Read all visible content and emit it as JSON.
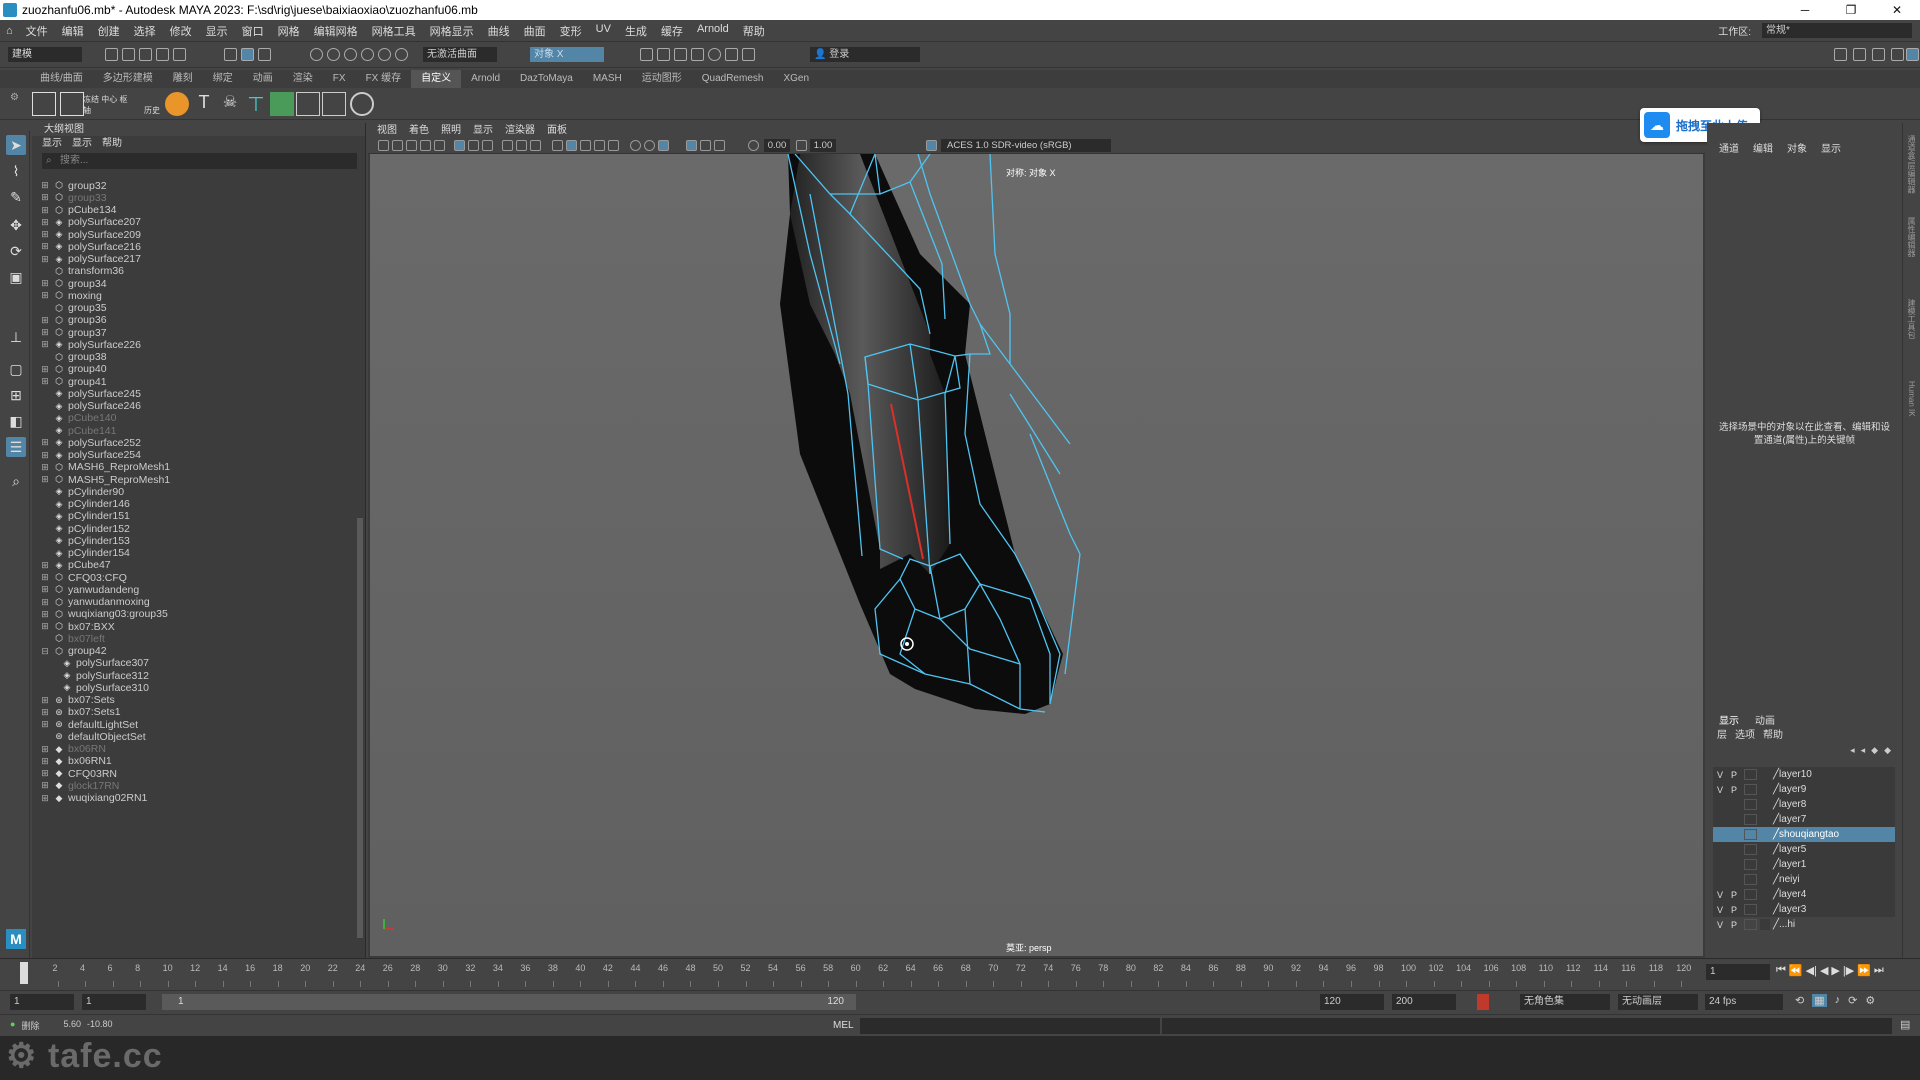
{
  "window": {
    "title": "zuozhanfu06.mb* - Autodesk MAYA 2023: F:\\sd\\rig\\juese\\baixiaoxiao\\zuozhanfu06.mb",
    "min": "─",
    "max": "❐",
    "close": "✕"
  },
  "menubar": {
    "items": [
      "文件",
      "编辑",
      "创建",
      "选择",
      "修改",
      "显示",
      "窗口",
      "网格",
      "编辑网格",
      "网格工具",
      "网格显示",
      "曲线",
      "曲面",
      "变形",
      "UV",
      "生成",
      "缓存",
      "Arnold",
      "帮助"
    ],
    "workspace_label": "工作区:",
    "workspace_value": "常规*"
  },
  "statusline": {
    "mode": "建模",
    "live_surface": "无激活曲面",
    "symmetry": "对象 X",
    "login": "登录"
  },
  "shelf": {
    "tabs": [
      "曲线/曲面",
      "多边形建模",
      "雕刻",
      "绑定",
      "动画",
      "渲染",
      "FX",
      "FX 缓存",
      "自定义",
      "Arnold",
      "DazToMaya",
      "MASH",
      "运动图形",
      "QuadRemesh",
      "XGen"
    ],
    "active_tab": "自定义",
    "labels": [
      "冻结 中心 枢轴",
      "历史"
    ]
  },
  "outliner": {
    "title": "大纲视图",
    "menu": [
      "显示",
      "显示",
      "帮助"
    ],
    "search_placeholder": "搜索...",
    "items": [
      {
        "name": "group32",
        "indent": 0,
        "exp": "⊞",
        "icon": "transform",
        "dim": false
      },
      {
        "name": "group33",
        "indent": 0,
        "exp": "⊞",
        "icon": "transform",
        "dim": true
      },
      {
        "name": "pCube134",
        "indent": 0,
        "exp": "⊞",
        "icon": "transform",
        "dim": false
      },
      {
        "name": "polySurface207",
        "indent": 0,
        "exp": "⊞",
        "icon": "mesh",
        "dim": false
      },
      {
        "name": "polySurface209",
        "indent": 0,
        "exp": "⊞",
        "icon": "mesh",
        "dim": false
      },
      {
        "name": "polySurface216",
        "indent": 0,
        "exp": "⊞",
        "icon": "mesh",
        "dim": false
      },
      {
        "name": "polySurface217",
        "indent": 0,
        "exp": "⊞",
        "icon": "mesh",
        "dim": false
      },
      {
        "name": "transform36",
        "indent": 0,
        "exp": "",
        "icon": "transform",
        "dim": false
      },
      {
        "name": "group34",
        "indent": 0,
        "exp": "⊞",
        "icon": "transform",
        "dim": false
      },
      {
        "name": "moxing",
        "indent": 0,
        "exp": "⊞",
        "icon": "transform",
        "dim": false
      },
      {
        "name": "group35",
        "indent": 0,
        "exp": "",
        "icon": "transform",
        "dim": false
      },
      {
        "name": "group36",
        "indent": 0,
        "exp": "⊞",
        "icon": "transform",
        "dim": false
      },
      {
        "name": "group37",
        "indent": 0,
        "exp": "⊞",
        "icon": "transform",
        "dim": false
      },
      {
        "name": "polySurface226",
        "indent": 0,
        "exp": "⊞",
        "icon": "mesh",
        "dim": false
      },
      {
        "name": "group38",
        "indent": 0,
        "exp": "",
        "icon": "transform",
        "dim": false
      },
      {
        "name": "group40",
        "indent": 0,
        "exp": "⊞",
        "icon": "transform",
        "dim": false
      },
      {
        "name": "group41",
        "indent": 0,
        "exp": "⊞",
        "icon": "transform",
        "dim": false
      },
      {
        "name": "polySurface245",
        "indent": 0,
        "exp": "",
        "icon": "mesh",
        "dim": false
      },
      {
        "name": "polySurface246",
        "indent": 0,
        "exp": "",
        "icon": "mesh",
        "dim": false
      },
      {
        "name": "pCube140",
        "indent": 0,
        "exp": "",
        "icon": "mesh",
        "dim": true
      },
      {
        "name": "pCube141",
        "indent": 0,
        "exp": "",
        "icon": "mesh",
        "dim": true
      },
      {
        "name": "polySurface252",
        "indent": 0,
        "exp": "⊞",
        "icon": "mesh",
        "dim": false
      },
      {
        "name": "polySurface254",
        "indent": 0,
        "exp": "⊞",
        "icon": "mesh",
        "dim": false
      },
      {
        "name": "MASH6_ReproMesh1",
        "indent": 0,
        "exp": "⊞",
        "icon": "transform",
        "dim": false
      },
      {
        "name": "MASH5_ReproMesh1",
        "indent": 0,
        "exp": "⊞",
        "icon": "transform",
        "dim": false
      },
      {
        "name": "pCylinder90",
        "indent": 0,
        "exp": "",
        "icon": "mesh",
        "dim": false
      },
      {
        "name": "pCylinder146",
        "indent": 0,
        "exp": "",
        "icon": "mesh",
        "dim": false
      },
      {
        "name": "pCylinder151",
        "indent": 0,
        "exp": "",
        "icon": "mesh",
        "dim": false
      },
      {
        "name": "pCylinder152",
        "indent": 0,
        "exp": "",
        "icon": "mesh",
        "dim": false
      },
      {
        "name": "pCylinder153",
        "indent": 0,
        "exp": "",
        "icon": "mesh",
        "dim": false
      },
      {
        "name": "pCylinder154",
        "indent": 0,
        "exp": "",
        "icon": "mesh",
        "dim": false
      },
      {
        "name": "pCube47",
        "indent": 0,
        "exp": "⊞",
        "icon": "mesh",
        "dim": false
      },
      {
        "name": "CFQ03:CFQ",
        "indent": 0,
        "exp": "⊞",
        "icon": "transform",
        "dim": false
      },
      {
        "name": "yanwudandeng",
        "indent": 0,
        "exp": "⊞",
        "icon": "transform",
        "dim": false
      },
      {
        "name": "yanwudanmoxing",
        "indent": 0,
        "exp": "⊞",
        "icon": "transform",
        "dim": false
      },
      {
        "name": "wuqixiang03:group35",
        "indent": 0,
        "exp": "⊞",
        "icon": "transform",
        "dim": false
      },
      {
        "name": "bx07:BXX",
        "indent": 0,
        "exp": "⊞",
        "icon": "transform",
        "dim": false
      },
      {
        "name": "bx07left",
        "indent": 0,
        "exp": "",
        "icon": "transform",
        "dim": true
      },
      {
        "name": "group42",
        "indent": 0,
        "exp": "⊟",
        "icon": "transform",
        "dim": false
      },
      {
        "name": "polySurface307",
        "indent": 1,
        "exp": "",
        "icon": "mesh",
        "dim": false
      },
      {
        "name": "polySurface312",
        "indent": 1,
        "exp": "",
        "icon": "mesh",
        "dim": false
      },
      {
        "name": "polySurface310",
        "indent": 1,
        "exp": "",
        "icon": "mesh",
        "dim": false
      },
      {
        "name": "bx07:Sets",
        "indent": 0,
        "exp": "⊞",
        "icon": "set",
        "dim": false
      },
      {
        "name": "bx07:Sets1",
        "indent": 0,
        "exp": "⊞",
        "icon": "set",
        "dim": false
      },
      {
        "name": "defaultLightSet",
        "indent": 0,
        "exp": "⊞",
        "icon": "set",
        "dim": false
      },
      {
        "name": "defaultObjectSet",
        "indent": 0,
        "exp": "",
        "icon": "set",
        "dim": false
      },
      {
        "name": "bx06RN",
        "indent": 0,
        "exp": "⊞",
        "icon": "ref",
        "dim": true
      },
      {
        "name": "bx06RN1",
        "indent": 0,
        "exp": "⊞",
        "icon": "ref",
        "dim": false
      },
      {
        "name": "CFQ03RN",
        "indent": 0,
        "exp": "⊞",
        "icon": "ref",
        "dim": false
      },
      {
        "name": "glock17RN",
        "indent": 0,
        "exp": "⊞",
        "icon": "ref",
        "dim": true
      },
      {
        "name": "wuqixiang02RN1",
        "indent": 0,
        "exp": "⊞",
        "icon": "ref",
        "dim": false
      }
    ]
  },
  "viewport": {
    "menu": [
      "视图",
      "着色",
      "照明",
      "显示",
      "渲染器",
      "面板"
    ],
    "exposure": "0.00",
    "gamma": "1.00",
    "color_space": "ACES 1.0 SDR-video (sRGB)",
    "symmetry_label": "对称: 对象 X",
    "camera_label": "莫亚: persp"
  },
  "upload_button": {
    "label": "拖拽至此上传"
  },
  "channel_box": {
    "tabs": [
      "通道",
      "编辑",
      "对象",
      "显示"
    ],
    "message": "选择场景中的对象以在此查看、编辑和设置通道(属性)上的关键帧"
  },
  "layer_editor": {
    "tabs": [
      "显示",
      "动画"
    ],
    "menu": [
      "层",
      "选项",
      "帮助"
    ],
    "layers": [
      {
        "name": "layer10",
        "v": "V",
        "p": "P",
        "color": "#3a3a3a",
        "selected": false
      },
      {
        "name": "layer9",
        "v": "V",
        "p": "P",
        "color": "#3a3a3a",
        "selected": false
      },
      {
        "name": "layer8",
        "v": "",
        "p": "",
        "color": "#3a3a3a",
        "selected": false
      },
      {
        "name": "layer7",
        "v": "",
        "p": "",
        "color": "#3a3a3a",
        "selected": false
      },
      {
        "name": "shouqiangtao",
        "v": "",
        "p": "",
        "color": "#5285a6",
        "selected": true
      },
      {
        "name": "layer5",
        "v": "",
        "p": "",
        "color": "#3a3a3a",
        "selected": false
      },
      {
        "name": "layer1",
        "v": "",
        "p": "",
        "color": "#3a3a3a",
        "selected": false
      },
      {
        "name": "neiyi",
        "v": "",
        "p": "",
        "color": "#3a3a3a",
        "selected": false
      },
      {
        "name": "layer4",
        "v": "V",
        "p": "P",
        "color": "#3a3a3a",
        "selected": false
      },
      {
        "name": "layer3",
        "v": "V",
        "p": "P",
        "color": "#3a3a3a",
        "selected": false
      },
      {
        "name": "...hi",
        "v": "V",
        "p": "P",
        "color": "#3a3a3a",
        "selected": false
      }
    ]
  },
  "side_strip": [
    "通道盒/层编辑器",
    "属性编辑器",
    "建模工具包",
    "Human IK"
  ],
  "timeline": {
    "ticks": [
      "2",
      "4",
      "6",
      "8",
      "10",
      "12",
      "14",
      "16",
      "18",
      "20",
      "22",
      "24",
      "26",
      "28",
      "30",
      "32",
      "34",
      "36",
      "38",
      "40",
      "42",
      "44",
      "46",
      "48",
      "50",
      "52",
      "54",
      "56",
      "58",
      "60",
      "62",
      "64",
      "66",
      "68",
      "70",
      "72",
      "74",
      "76",
      "78",
      "80",
      "82",
      "84",
      "86",
      "88",
      "90",
      "92",
      "94",
      "96",
      "98",
      "100",
      "102",
      "104",
      "106",
      "108",
      "110",
      "112",
      "114",
      "116",
      "118",
      "120"
    ],
    "current_frame": "1"
  },
  "range": {
    "start": "1",
    "inner_start": "1",
    "bar_start": "1",
    "bar_end": "120",
    "end": "120",
    "outer_end": "200",
    "char_set": "无角色集",
    "anim_layer": "无动画层",
    "fps": "24 fps"
  },
  "cmdline": {
    "label": "MEL"
  },
  "helpline": {
    "text": "删除",
    "x": "5.60",
    "y": "-10.80"
  },
  "watermark": "tafe.cc"
}
